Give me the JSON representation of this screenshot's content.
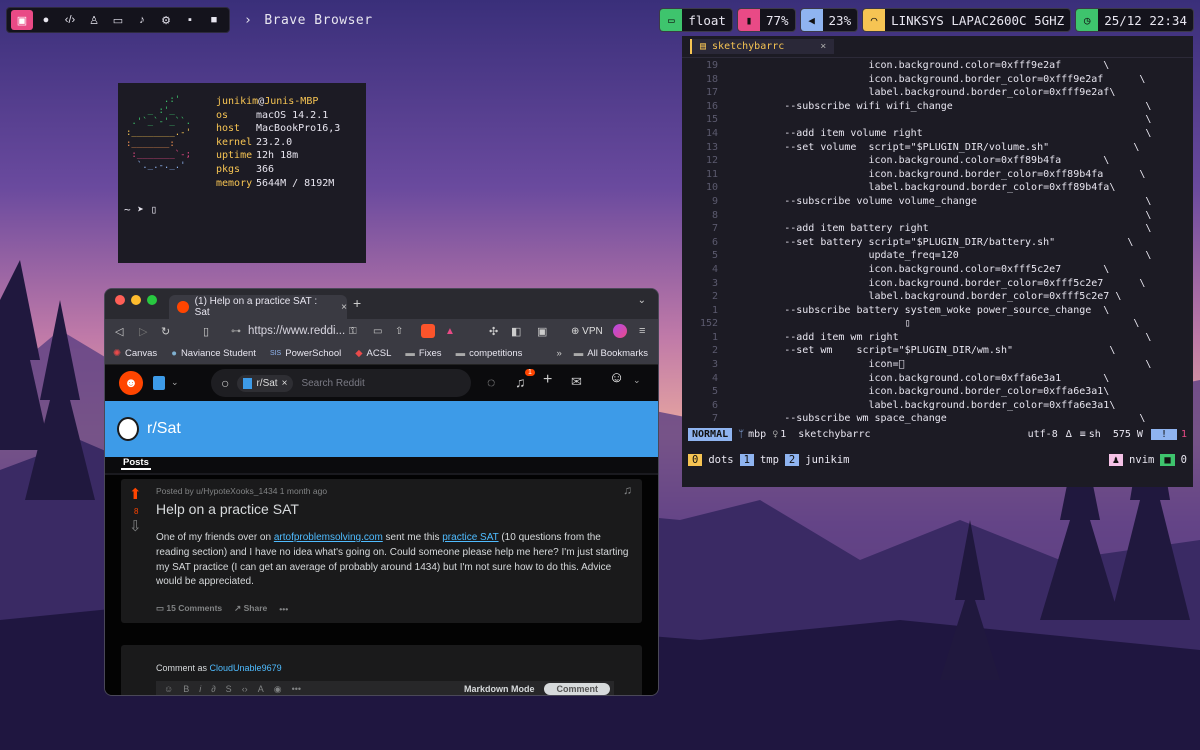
{
  "topbar": {
    "workspace_icons": [
      "terminal-icon",
      "github-icon",
      "code-icon",
      "user-icon",
      "monitor-icon",
      "music-icon",
      "gear-icon",
      "chat-icon",
      "camera-icon"
    ],
    "app_name": "Brave Browser",
    "layout": "float",
    "battery": "77%",
    "volume": "23%",
    "wifi": "LINKSYS LAPAC2600C 5GHZ",
    "clock": "25/12 22:34",
    "colors": {
      "layout": "#3ec46d",
      "battery": "#e94a86",
      "volume": "#8fb4f0",
      "wifi": "#f6c453",
      "clock": "#3ec46d"
    }
  },
  "neofetch": {
    "user": "junikim",
    "host_name": "Junis-MBP",
    "rows": [
      {
        "k": "os",
        "v": "macOS 14.2.1"
      },
      {
        "k": "host",
        "v": "MacBookPro16,3"
      },
      {
        "k": "kernel",
        "v": "23.2.0"
      },
      {
        "k": "uptime",
        "v": "12h 18m"
      },
      {
        "k": "pkgs",
        "v": "366"
      },
      {
        "k": "memory",
        "v": "5644M / 8192M"
      }
    ],
    "prompt": "~ ➤ ▯"
  },
  "terminal": {
    "tab_title": "sketchybarrc",
    "lines": [
      {
        "n": "19",
        "t": "                        icon.background.color=0xfff9e2af       \\"
      },
      {
        "n": "18",
        "t": "                        icon.background.border_color=0xfff9e2af      \\"
      },
      {
        "n": "17",
        "t": "                        label.background.border_color=0xfff9e2af\\"
      },
      {
        "n": "16",
        "t": "          --subscribe wifi wifi_change                                \\"
      },
      {
        "n": "15",
        "t": "                                                                      \\"
      },
      {
        "n": "14",
        "t": "          --add item volume right                                     \\"
      },
      {
        "n": "13",
        "t": "          --set volume  script=\"$PLUGIN_DIR/volume.sh\"              \\"
      },
      {
        "n": "12",
        "t": "                        icon.background.color=0xff89b4fa       \\"
      },
      {
        "n": "11",
        "t": "                        icon.background.border_color=0xff89b4fa      \\"
      },
      {
        "n": "10",
        "t": "                        label.background.border_color=0xff89b4fa\\"
      },
      {
        "n": "9",
        "t": "          --subscribe volume volume_change                            \\"
      },
      {
        "n": "8",
        "t": "                                                                      \\"
      },
      {
        "n": "7",
        "t": "          --add item battery right                                    \\"
      },
      {
        "n": "6",
        "t": "          --set battery script=\"$PLUGIN_DIR/battery.sh\"            \\"
      },
      {
        "n": "5",
        "t": "                        update_freq=120                               \\"
      },
      {
        "n": "4",
        "t": "                        icon.background.color=0xfff5c2e7       \\"
      },
      {
        "n": "3",
        "t": "                        icon.background.border_color=0xfff5c2e7      \\"
      },
      {
        "n": "2",
        "t": "                        label.background.border_color=0xfff5c2e7 \\"
      },
      {
        "n": "1",
        "t": "          --subscribe battery system_woke power_source_change  \\"
      },
      {
        "n": "152",
        "t": "                              ▯                                     \\"
      },
      {
        "n": "1",
        "t": "          --add item wm right                                         \\"
      },
      {
        "n": "2",
        "t": "          --set wm    script=\"$PLUGIN_DIR/wm.sh\"                \\"
      },
      {
        "n": "3",
        "t": "                        icon=󰙀                                        \\"
      },
      {
        "n": "4",
        "t": "                        icon.background.color=0xffa6e3a1       \\"
      },
      {
        "n": "5",
        "t": "                        icon.background.border_color=0xffa6e3a1\\"
      },
      {
        "n": "6",
        "t": "                        label.background.border_color=0xffa6e3a1\\"
      },
      {
        "n": "7",
        "t": "          --subscribe wm space_change                                \\"
      }
    ],
    "status": {
      "mode": "NORMAL",
      "branch": "mbp",
      "count": "1",
      "file": "sketchybarrc",
      "enc": "utf-8",
      "ft": "sh",
      "words": "575 W",
      "diag": "1"
    },
    "tmux": {
      "windows": [
        {
          "i": "0",
          "name": "dots",
          "c": "#f6c453"
        },
        {
          "i": "1",
          "name": "tmp",
          "c": "#8fb4f0"
        },
        {
          "i": "2",
          "name": "junikim",
          "c": "#8fb4f0"
        }
      ],
      "right_app": "nvim",
      "right_num": "0"
    }
  },
  "browser": {
    "tab_title": "(1) Help on a practice SAT : Sat",
    "url": "https://www.reddi...",
    "vpn": "VPN",
    "bookmarks": [
      "Canvas",
      "Naviance Student",
      "PowerSchool",
      "ACSL",
      "Fixes",
      "competitions"
    ],
    "all_bookmarks": "All Bookmarks",
    "sub_pill": "r/Sat",
    "search_placeholder": "Search Reddit",
    "notif_count": "1",
    "banner_title": "r/Sat",
    "posts_tab": "Posts",
    "post": {
      "meta": "Posted by u/HypoteXooks_1434 1 month ago",
      "votes": "8",
      "title": "Help on a practice SAT",
      "body_1": "One of my friends over on ",
      "link_1": "artofproblemsolving.com",
      "body_2": " sent me this ",
      "link_2": "practice SAT",
      "body_3": " (10 questions from the reading section) and I have no idea what's going on. Could someone please help me here? I'm just starting my SAT practice (I can get an average of probably around 1434) but I'm not sure how to do this. Advice would be appreciated.",
      "comments": "15 Comments",
      "share": "Share"
    },
    "comment_as": "Comment as ",
    "comment_user": "CloudUnable9679",
    "markdown_mode": "Markdown Mode",
    "comment_btn": "Comment"
  }
}
